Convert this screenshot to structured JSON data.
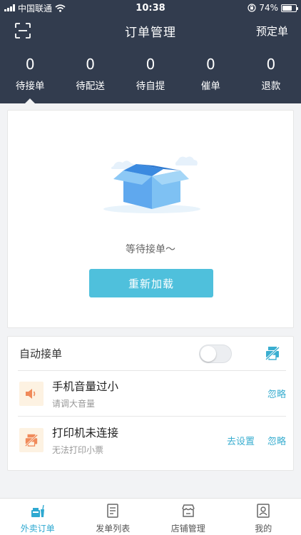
{
  "status_bar": {
    "carrier": "中国联通",
    "time": "10:38",
    "battery": "74%",
    "battery_level": 0.74
  },
  "nav": {
    "title": "订单管理",
    "right_action": "预定单"
  },
  "stats": [
    {
      "count": "0",
      "label": "待接单"
    },
    {
      "count": "0",
      "label": "待配送"
    },
    {
      "count": "0",
      "label": "待自提"
    },
    {
      "count": "0",
      "label": "催单"
    },
    {
      "count": "0",
      "label": "退款"
    }
  ],
  "empty": {
    "message": "等待接单～",
    "reload_label": "重新加载"
  },
  "settings": {
    "auto_accept_label": "自动接单",
    "auto_accept_on": false
  },
  "alerts": [
    {
      "title": "手机音量过小",
      "subtitle": "请调大音量",
      "ignore_label": "忽略"
    },
    {
      "title": "打印机未连接",
      "subtitle": "无法打印小票",
      "settings_label": "去设置",
      "ignore_label": "忽略"
    }
  ],
  "tabs": [
    {
      "label": "外卖订单",
      "icon": "takeout-order-icon"
    },
    {
      "label": "发单列表",
      "icon": "order-list-icon"
    },
    {
      "label": "店铺管理",
      "icon": "store-icon"
    },
    {
      "label": "我的",
      "icon": "profile-icon"
    }
  ],
  "colors": {
    "header_bg": "#323c4e",
    "accent": "#4fc0dc",
    "tab_active": "#2fa9d1",
    "alert_icon_bg": "#fdf2e2"
  }
}
